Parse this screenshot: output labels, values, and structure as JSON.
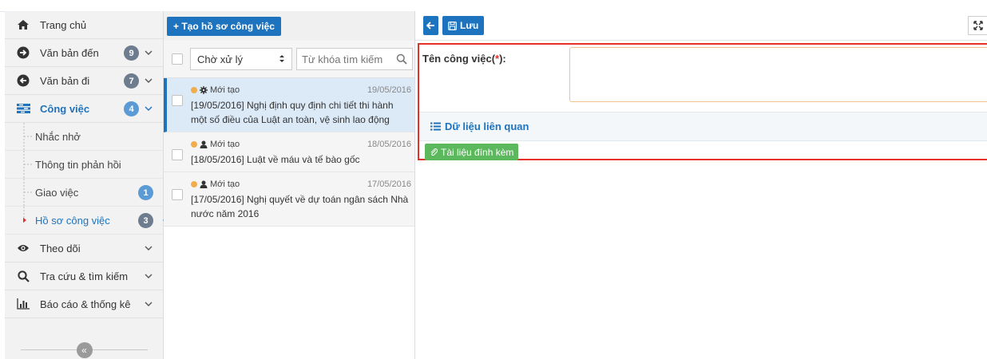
{
  "sidebar": {
    "items": [
      {
        "label": "Trang chủ",
        "icon": "home-icon"
      },
      {
        "label": "Văn bản đến",
        "icon": "arrow-circle-right-icon",
        "badge": "9"
      },
      {
        "label": "Văn bản đi",
        "icon": "arrow-circle-left-icon",
        "badge": "7"
      },
      {
        "label": "Công việc",
        "icon": "tasks-icon",
        "badge": "4"
      }
    ],
    "subitems": [
      {
        "label": "Nhắc nhở"
      },
      {
        "label": "Thông tin phản hồi"
      },
      {
        "label": "Giao việc",
        "badge": "1"
      },
      {
        "label": "Hồ sơ công việc",
        "badge": "3"
      }
    ],
    "bottom_items": [
      {
        "label": "Theo dõi",
        "icon": "eye-icon"
      },
      {
        "label": "Tra cứu & tìm kiếm",
        "icon": "search-icon"
      },
      {
        "label": "Báo cáo & thống kê",
        "icon": "bar-chart-icon"
      }
    ],
    "collapse_glyph": "«"
  },
  "list": {
    "create_button": "+ Tạo hồ sơ công việc",
    "filter_value": "Chờ xử lý",
    "search_placeholder": "Từ khóa tìm kiếm",
    "items": [
      {
        "status": "Mới tạo",
        "status_icon": "gear-icon",
        "date": "19/05/2016",
        "title": "[19/05/2016] Nghị định quy định chi tiết thi hành một số điều của Luật an toàn, vệ sinh lao động"
      },
      {
        "status": "Mới tạo",
        "status_icon": "user-icon",
        "date": "18/05/2016",
        "title": "[18/05/2016] Luật về máu và tế bào gốc"
      },
      {
        "status": "Mới tạo",
        "status_icon": "user-icon",
        "date": "17/05/2016",
        "title": "[17/05/2016] Nghị quyết về dự toán ngân sách Nhà nước năm 2016"
      }
    ]
  },
  "detail": {
    "save_label": "Lưu",
    "field_label": "Tên công việc(",
    "field_required": "*",
    "field_label_end": "):",
    "related_label": "Dữ liệu liên quan",
    "attach_label": "Tài liệu đính kèm"
  },
  "colors": {
    "primary": "#1e73be",
    "highlight_border": "#e8302a",
    "success": "#5cb85c",
    "status_dot": "#f0ad4e"
  }
}
